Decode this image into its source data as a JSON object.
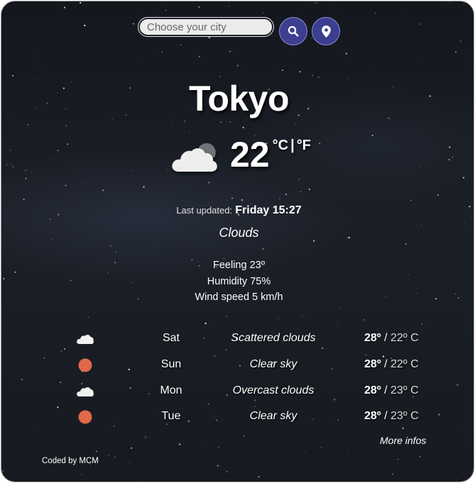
{
  "search": {
    "placeholder": "Choose your city",
    "value": ""
  },
  "icons": {
    "search": "search-icon",
    "location": "location-pin-icon",
    "current_weather": "cloud-icon"
  },
  "current": {
    "city": "Tokyo",
    "temperature": "22",
    "unit_celsius": "°C",
    "unit_separator": "|",
    "unit_fahrenheit": "°F",
    "last_updated_label": "Last updated:",
    "last_updated_value": "Friday 15:27",
    "description": "Clouds",
    "feeling": "Feeling 23º",
    "humidity": "Humidity 75%",
    "wind": "Wind speed 5 km/h"
  },
  "forecast": [
    {
      "icon": "cloud-icon",
      "day": "Sat",
      "description": "Scattered clouds",
      "max": "28º",
      "slash": " / ",
      "min": "22º C"
    },
    {
      "icon": "sun-icon",
      "day": "Sun",
      "description": "Clear sky",
      "max": "28º",
      "slash": " / ",
      "min": "22º C"
    },
    {
      "icon": "cloud-icon",
      "day": "Mon",
      "description": "Overcast clouds",
      "max": "28º",
      "slash": " / ",
      "min": "23º C"
    },
    {
      "icon": "sun-icon",
      "day": "Tue",
      "description": "Clear sky",
      "max": "28º",
      "slash": " / ",
      "min": "23º C"
    }
  ],
  "footer": {
    "more_link": "More infos",
    "credit": "Coded by MCM"
  },
  "colors": {
    "button": "#3c3f8f",
    "sun": "#e0694a",
    "background": "#171a20"
  }
}
